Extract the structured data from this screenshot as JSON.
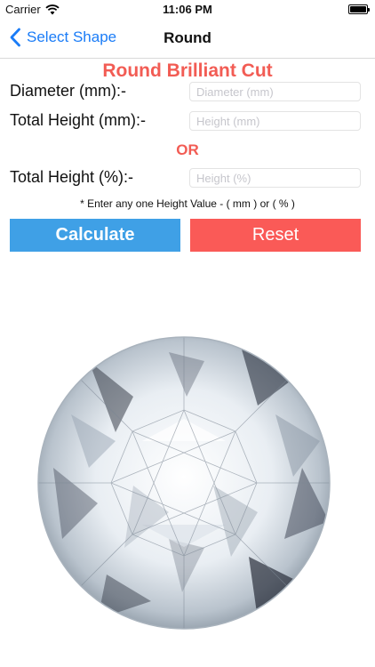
{
  "status_bar": {
    "carrier": "Carrier",
    "time": "11:06 PM"
  },
  "nav": {
    "back_label": "Select Shape",
    "title": "Round"
  },
  "form": {
    "heading": "Round Brilliant Cut",
    "diameter": {
      "label": "Diameter (mm):-",
      "placeholder": "Diameter (mm)",
      "value": ""
    },
    "height_mm": {
      "label": "Total Height (mm):-",
      "placeholder": "Height (mm)",
      "value": ""
    },
    "or_label": "OR",
    "height_pct": {
      "label": "Total Height (%):-",
      "placeholder": "Height (%)",
      "value": ""
    },
    "hint": "* Enter any one Height Value - ( mm ) or ( % )"
  },
  "buttons": {
    "calculate_label": "Calculate",
    "reset_label": "Reset"
  },
  "colors": {
    "accent_red": "#f25c54",
    "calculate_blue": "#3fa0e6",
    "reset_red": "#fa5a57",
    "link_blue": "#1a7cf7"
  },
  "icons": {
    "back": "chevron-left-icon",
    "wifi": "wifi-icon",
    "battery": "battery-icon",
    "diamond": "round-diamond-illustration"
  }
}
